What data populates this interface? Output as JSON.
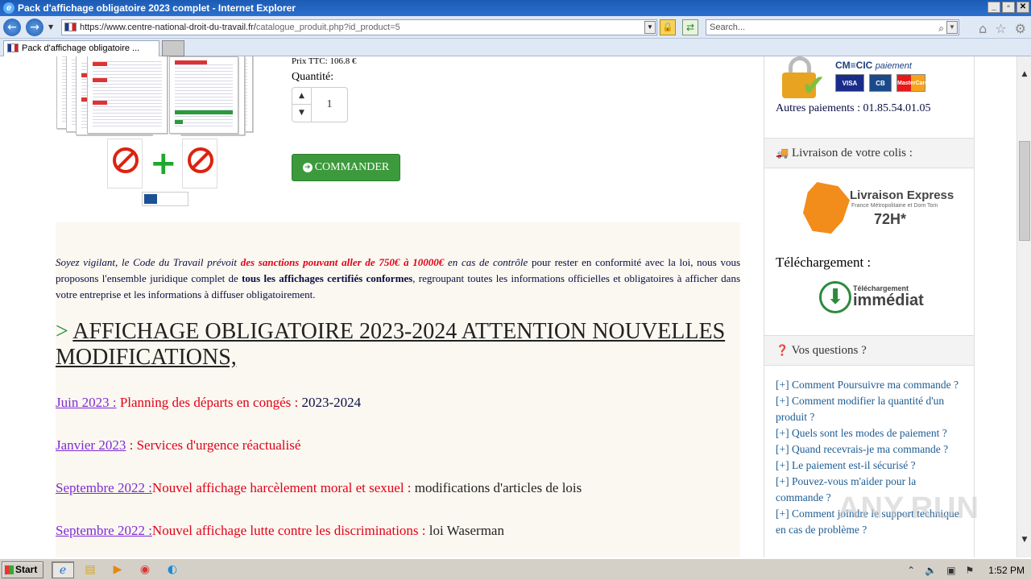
{
  "window": {
    "title": "Pack d'affichage obligatoire 2023 complet - Internet Explorer",
    "min": "_",
    "max": "▫",
    "close": "✕"
  },
  "address": {
    "host": "https://www.centre-national-droit-du-travail.fr/",
    "path": "catalogue_produit.php?id_product=5",
    "search_placeholder": "Search..."
  },
  "tab": {
    "label": "Pack d'affichage obligatoire ..."
  },
  "product": {
    "price": "Prix TTC: 106.8 €",
    "quantity_label": "Quantité:",
    "quantity_value": "1",
    "order_button": "COMMANDER"
  },
  "intro": {
    "p1": "Soyez vigilant, le Code du Travail prévoit",
    "p1_red": "des sanctions pouvant aller de 750€ à 10000€",
    "p1_end": "en cas de contrôle",
    "p2": "pour rester en conformité avec la loi, nous vous proposons l'ensemble juridique complet de",
    "p2_bold": "tous les affichages certifiés conformes",
    "p3": ", regroupant toutes les informations officielles et obligatoires à afficher dans votre entreprise et les informations à diffuser obligatoirement."
  },
  "heading": {
    "gt": ">",
    "text": "AFFICHAGE OBLIGATOIRE 2023-2024 ATTENTION NOUVELLES MODIFICATIONS,"
  },
  "updates": [
    {
      "date": "Juin 2023 :",
      "desc": "Planning des départs en congés :",
      "extra": "2023-2024"
    },
    {
      "date": "Janvier 2023",
      "desc": ": Services d'urgence réactualisé",
      "extra": ""
    },
    {
      "date": "Septembre 2022 :",
      "desc": "Nouvel affichage harcèlement moral et sexuel :",
      "extra": "modifications d'articles de lois"
    },
    {
      "date": "Septembre 2022 :",
      "desc": "Nouvel affichage lutte contre les discriminations :",
      "extra": "loi Waserman"
    }
  ],
  "sidebar": {
    "cmcic": "CM≡CIC",
    "cmcic_pay": "paiement",
    "cards": [
      "VISA",
      "CB",
      "MasterCard"
    ],
    "autres": "Autres paiements : 01.85.54.01.05",
    "livraison_title": "Livraison de votre colis :",
    "express": {
      "title": "Livraison Express",
      "sub": "France Métropolitaine et Dom Tom",
      "time": "72H*"
    },
    "telechargement": "Téléchargement :",
    "immediate": {
      "small": "Téléchargement",
      "big": "immédiat"
    },
    "questions_title": "Vos questions ?",
    "faq": [
      "[+] Comment Poursuivre ma commande ?",
      "[+] Comment modifier la quantité d'un produit ?",
      "[+] Quels sont les modes de paiement ?",
      "[+] Quand recevrais-je ma commande ?",
      "[+] Le paiement est-il sécurisé ?",
      "[+] Pouvez-vous m'aider pour la commande ?",
      "[+] Comment joindre le support technique en cas de problème ?"
    ]
  },
  "watermark": "ANY.RUN",
  "taskbar": {
    "start": "Start",
    "time": "1:52 PM"
  }
}
